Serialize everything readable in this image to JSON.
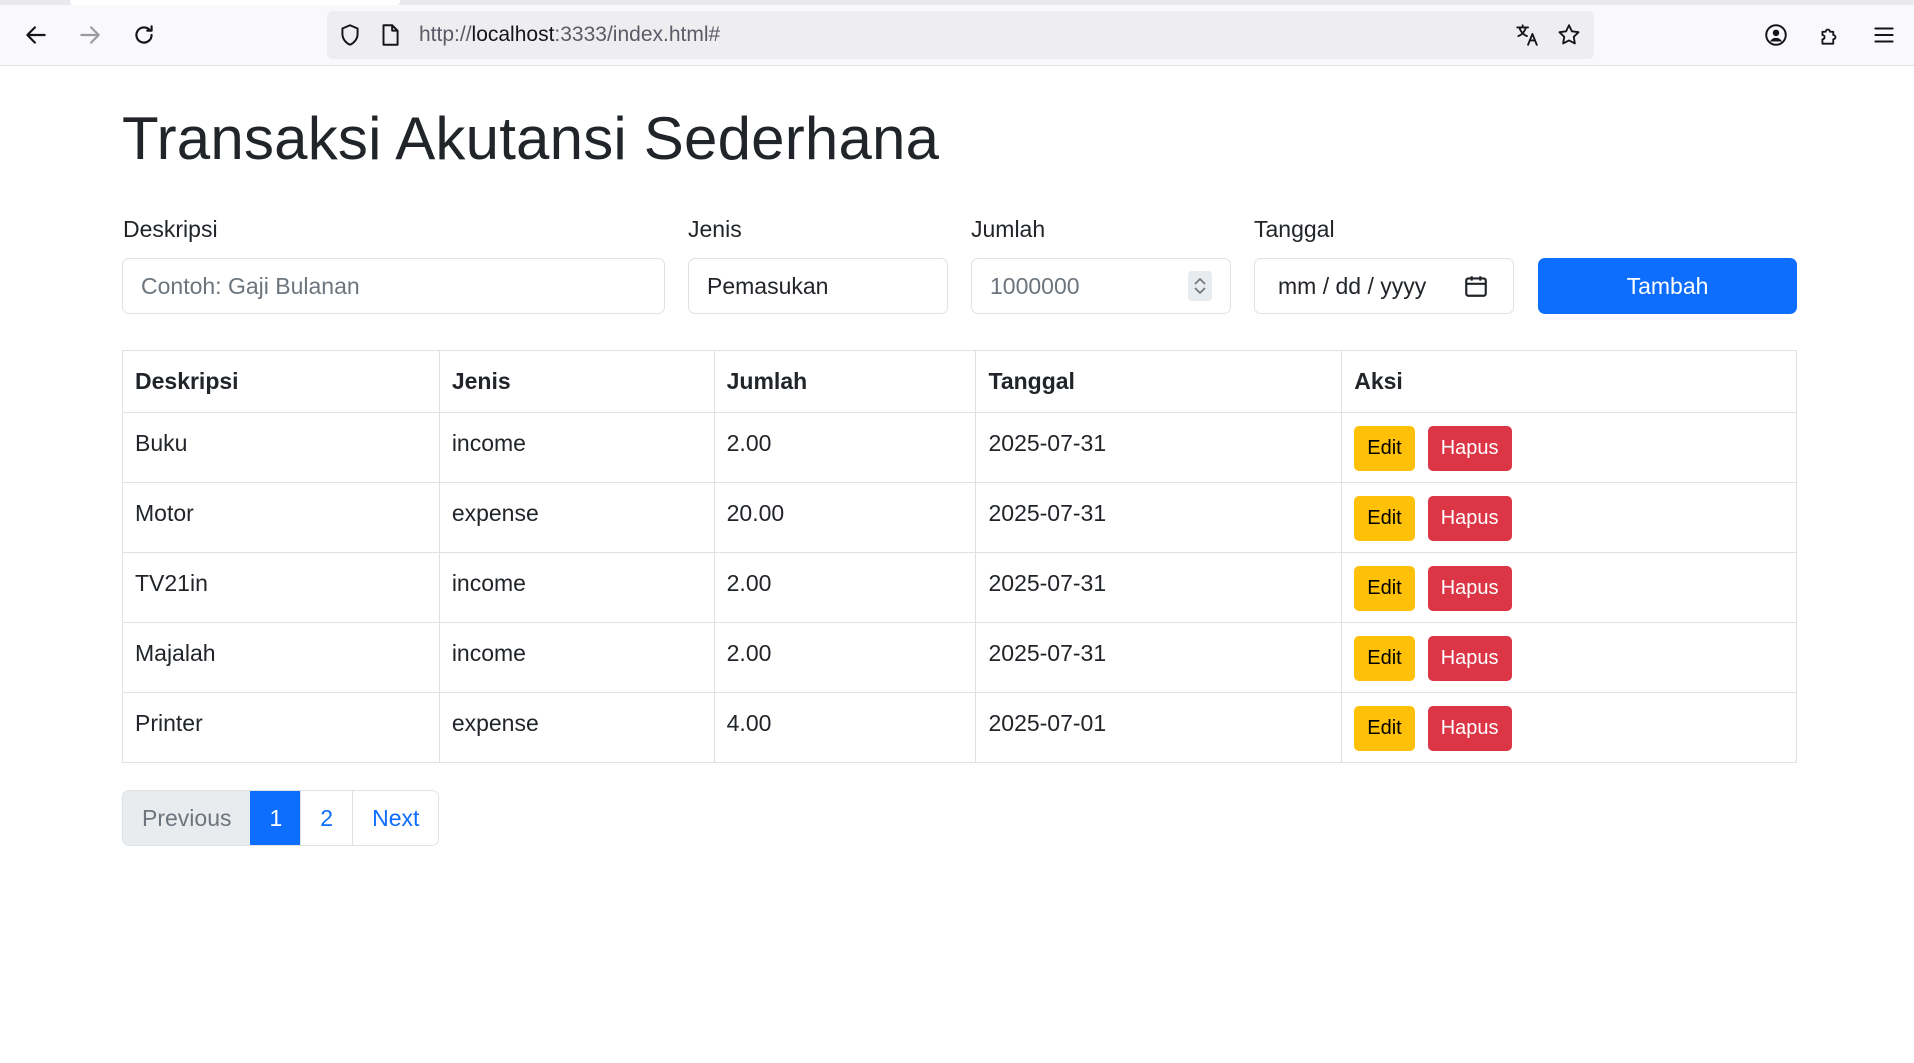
{
  "browser": {
    "url_prefix": "http://",
    "url_host": "localhost",
    "url_rest": ":3333/index.html#"
  },
  "page": {
    "title": "Transaksi Akutansi Sederhana"
  },
  "form": {
    "deskripsi_label": "Deskripsi",
    "deskripsi_placeholder": "Contoh: Gaji Bulanan",
    "jenis_label": "Jenis",
    "jenis_value": "Pemasukan",
    "jumlah_label": "Jumlah",
    "jumlah_placeholder": "1000000",
    "tanggal_label": "Tanggal",
    "tanggal_placeholder": "mm / dd / yyyy",
    "submit_label": "Tambah"
  },
  "table": {
    "headers": [
      "Deskripsi",
      "Jenis",
      "Jumlah",
      "Tanggal",
      "Aksi"
    ],
    "rows": [
      {
        "deskripsi": "Buku",
        "jenis": "income",
        "jumlah": "2.00",
        "tanggal": "2025-07-31"
      },
      {
        "deskripsi": "Motor",
        "jenis": "expense",
        "jumlah": "20.00",
        "tanggal": "2025-07-31"
      },
      {
        "deskripsi": "TV21in",
        "jenis": "income",
        "jumlah": "2.00",
        "tanggal": "2025-07-31"
      },
      {
        "deskripsi": "Majalah",
        "jenis": "income",
        "jumlah": "2.00",
        "tanggal": "2025-07-31"
      },
      {
        "deskripsi": "Printer",
        "jenis": "expense",
        "jumlah": "4.00",
        "tanggal": "2025-07-01"
      }
    ],
    "edit_label": "Edit",
    "delete_label": "Hapus"
  },
  "pagination": {
    "previous": "Previous",
    "pages": [
      "1",
      "2"
    ],
    "current": "1",
    "next": "Next"
  },
  "colors": {
    "primary": "#0d6efd",
    "warning": "#ffc107",
    "danger": "#dc3545"
  }
}
